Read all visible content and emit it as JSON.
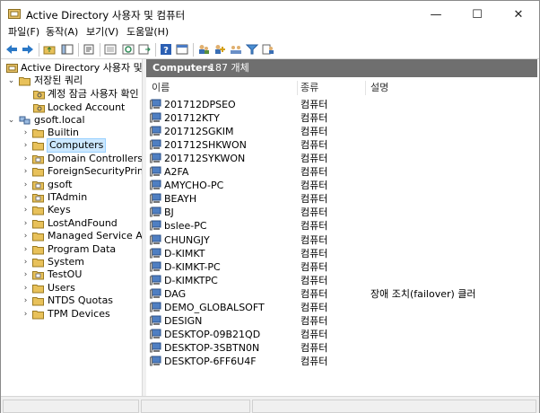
{
  "window": {
    "title": "Active Directory 사용자 및 컴퓨터",
    "minimize_glyph": "—",
    "maximize_glyph": "☐",
    "close_glyph": "✕"
  },
  "menu": [
    "파일(F)",
    "동작(A)",
    "보기(V)",
    "도움말(H)"
  ],
  "toolbar": {
    "icons": [
      "back-icon",
      "forward-icon",
      "up-folder-icon",
      "show-tree-icon",
      "properties-icon",
      "export-icon",
      "refresh-icon",
      "export-list-icon",
      "help-icon",
      "console-icon",
      "users-icon",
      "add-user-icon",
      "group-icon",
      "filter-icon",
      "delegate-icon"
    ]
  },
  "tree": {
    "root": "Active Directory 사용자 및 컴퓨",
    "saved_queries": "저장된 쿼리",
    "queries": [
      "계정 잠금 사용자 확인",
      "Locked Account"
    ],
    "domain": "gsoft.local",
    "containers": [
      "Builtin",
      "Computers",
      "Domain Controllers",
      "ForeignSecurityPrincipal",
      "gsoft",
      "ITAdmin",
      "Keys",
      "LostAndFound",
      "Managed Service Accou",
      "Program Data",
      "System",
      "TestOU",
      "Users",
      "NTDS Quotas",
      "TPM Devices"
    ],
    "selected": "Computers"
  },
  "list": {
    "header_title": "Computers",
    "header_count": "187 개체",
    "columns": [
      "이름",
      "종류",
      "설명"
    ],
    "rows": [
      {
        "name": "201712DPSEO",
        "type": "컴퓨터",
        "desc": ""
      },
      {
        "name": "201712KTY",
        "type": "컴퓨터",
        "desc": ""
      },
      {
        "name": "201712SGKIM",
        "type": "컴퓨터",
        "desc": ""
      },
      {
        "name": "201712SHKWON",
        "type": "컴퓨터",
        "desc": ""
      },
      {
        "name": "201712SYKWON",
        "type": "컴퓨터",
        "desc": ""
      },
      {
        "name": "A2FA",
        "type": "컴퓨터",
        "desc": ""
      },
      {
        "name": "AMYCHO-PC",
        "type": "컴퓨터",
        "desc": ""
      },
      {
        "name": "BEAYH",
        "type": "컴퓨터",
        "desc": ""
      },
      {
        "name": "BJ",
        "type": "컴퓨터",
        "desc": ""
      },
      {
        "name": "bslee-PC",
        "type": "컴퓨터",
        "desc": ""
      },
      {
        "name": "CHUNGJY",
        "type": "컴퓨터",
        "desc": ""
      },
      {
        "name": "D-KIMKT",
        "type": "컴퓨터",
        "desc": ""
      },
      {
        "name": "D-KIMKT-PC",
        "type": "컴퓨터",
        "desc": ""
      },
      {
        "name": "D-KIMKTPC",
        "type": "컴퓨터",
        "desc": ""
      },
      {
        "name": "DAG",
        "type": "컴퓨터",
        "desc": "장애 조치(failover) 클러"
      },
      {
        "name": "DEMO_GLOBALSOFT",
        "type": "컴퓨터",
        "desc": ""
      },
      {
        "name": "DESIGN",
        "type": "컴퓨터",
        "desc": ""
      },
      {
        "name": "DESKTOP-09B21QD",
        "type": "컴퓨터",
        "desc": ""
      },
      {
        "name": "DESKTOP-3SBTN0N",
        "type": "컴퓨터",
        "desc": ""
      },
      {
        "name": "DESKTOP-6FF6U4F",
        "type": "컴퓨터",
        "desc": ""
      }
    ]
  },
  "colors": {
    "header_bg": "#6f6f6f",
    "selection": "#cce8ff",
    "folder": "#e8c15a"
  }
}
